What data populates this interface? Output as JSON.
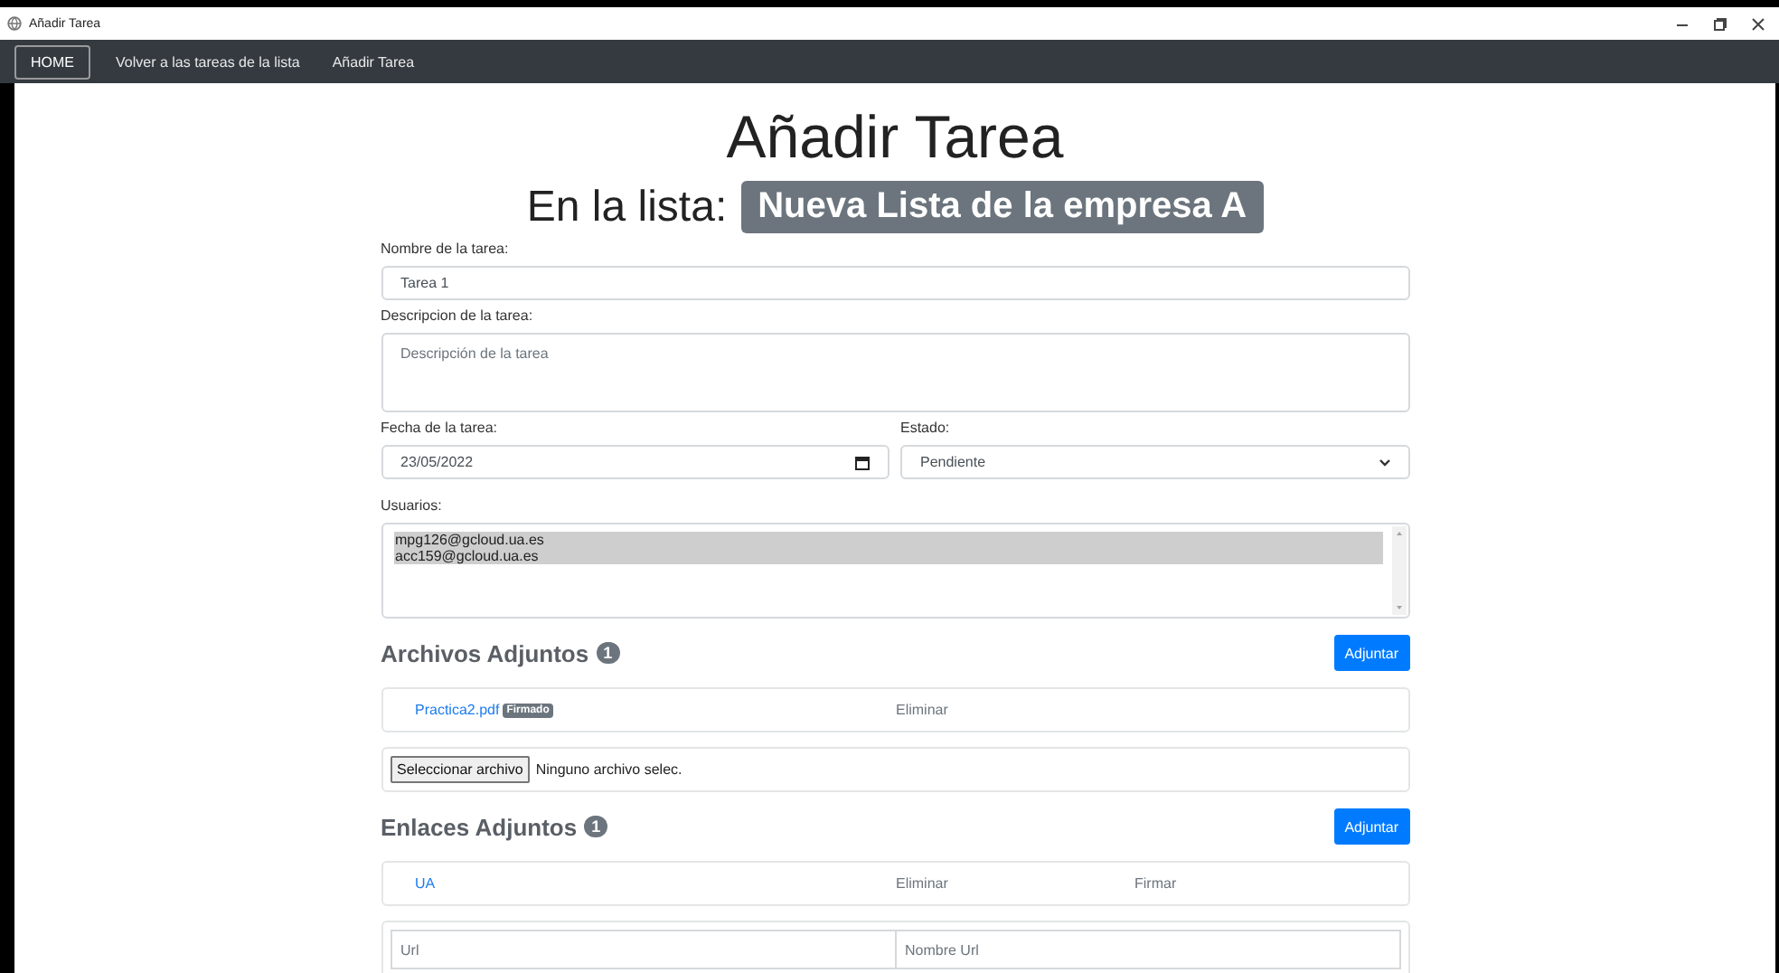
{
  "window": {
    "title": "Añadir Tarea"
  },
  "nav": [
    {
      "label": "HOME",
      "selected": true
    },
    {
      "label": "Volver a las tareas de la lista",
      "selected": false
    },
    {
      "label": "Añadir Tarea",
      "selected": false
    }
  ],
  "heading": "Añadir Tarea",
  "list_label": "En la lista:",
  "list_name": "Nueva Lista de la empresa A",
  "name_field": {
    "label": "Nombre de la tarea:",
    "value": "Tarea 1"
  },
  "description_field": {
    "label": "Descripcion de la tarea:",
    "placeholder": "Descripción de la tarea"
  },
  "date_field": {
    "label": "Fecha de la tarea:",
    "value": "23/05/2022"
  },
  "status_field": {
    "label": "Estado:",
    "value": "Pendiente"
  },
  "users_field": {
    "label": "Usuarios:",
    "options": [
      {
        "text": "mpg126@gcloud.ua.es",
        "selected": true
      },
      {
        "text": "acc159@gcloud.ua.es",
        "selected": true
      }
    ]
  },
  "files": {
    "title": "Archivos Adjuntos",
    "count": "1",
    "button": "Adjuntar",
    "items": [
      {
        "name": "Practica2.pdf",
        "badge": "Firmado",
        "actions": [
          "Eliminar"
        ]
      }
    ],
    "file_input": {
      "button": "Seleccionar archivo",
      "status": "Ninguno archivo selec."
    }
  },
  "links": {
    "title": "Enlaces Adjuntos",
    "count": "1",
    "button": "Adjuntar",
    "items": [
      {
        "name": "UA",
        "actions": [
          "Eliminar",
          "Firmar"
        ]
      }
    ],
    "new_link": {
      "url_placeholder": "Url",
      "name_placeholder": "Nombre Url"
    }
  }
}
